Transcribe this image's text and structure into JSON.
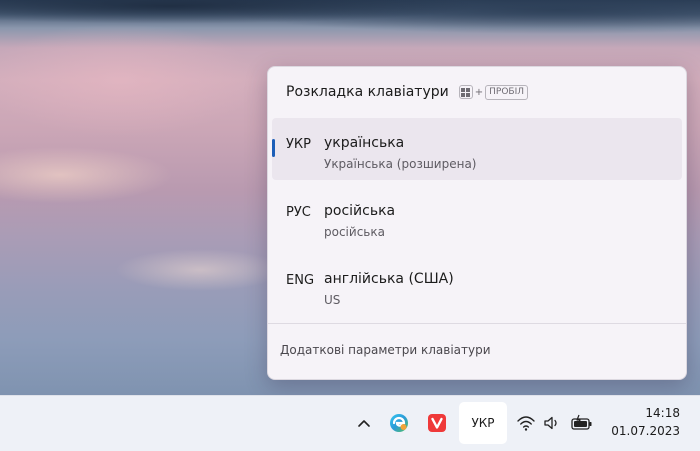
{
  "flyout": {
    "title": "Розкладка клавіатури",
    "shortcut": {
      "plus": "+",
      "key": "ПРОБІЛ"
    },
    "languages": [
      {
        "code": "УКР",
        "name": "українська",
        "layout": "Українська (розширена)",
        "selected": true
      },
      {
        "code": "РУС",
        "name": "російська",
        "layout": "російська",
        "selected": false
      },
      {
        "code": "ENG",
        "name": "англійська (США)",
        "layout": "US",
        "selected": false
      }
    ],
    "more_settings": "Додаткові параметри клавіатури"
  },
  "taskbar": {
    "language_indicator": "УКР",
    "chevron": "^",
    "icons": [
      "chevron-up-icon",
      "edge-icon",
      "vivaldi-icon",
      "wifi-icon",
      "speaker-icon",
      "battery-charging-icon"
    ],
    "time": "14:18",
    "date": "01.07.2023"
  },
  "colors": {
    "accent": "#1d5fb8",
    "flyout_bg": "#f6f3f8",
    "taskbar_bg": "#eef1f7"
  }
}
